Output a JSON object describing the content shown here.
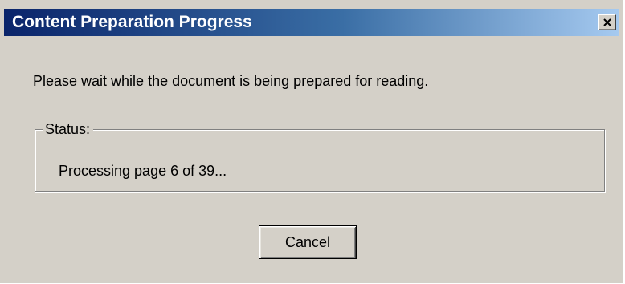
{
  "window": {
    "title": "Content Preparation Progress",
    "close_icon": "close-icon"
  },
  "message": "Please wait while the document is being prepared for reading.",
  "status": {
    "label": "Status:",
    "text": "Processing page 6 of 39..."
  },
  "buttons": {
    "cancel_label": "Cancel"
  },
  "colors": {
    "dialog_background": "#d4d0c8",
    "titlebar_start": "#0a246a",
    "titlebar_end": "#a6caf0",
    "title_text": "#ffffff"
  }
}
